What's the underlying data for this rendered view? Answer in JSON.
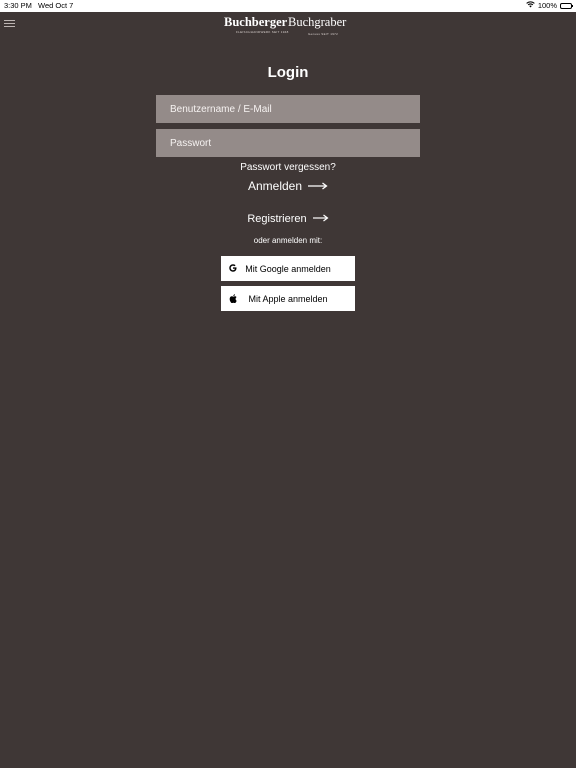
{
  "status_bar": {
    "time": "3:30 PM",
    "date": "Wed Oct 7",
    "battery": "100%"
  },
  "logo": {
    "left": "Buchberger",
    "left_sub": "FLEISCHHANDWERK SEIT 1948",
    "right": "Buchgraber",
    "right_sub": "Genuss SEIT 1972"
  },
  "login": {
    "title": "Login",
    "username_placeholder": "Benutzername / E-Mail",
    "password_placeholder": "Passwort",
    "forgot_password": "Passwort vergessen?",
    "login_button": "Anmelden",
    "register_button": "Registrieren",
    "alt_login_text": "oder anmelden mit:",
    "google_button": "Mit Google anmelden",
    "apple_button": "Mit Apple anmelden"
  },
  "colors": {
    "background": "#3f3736",
    "input_background": "#948b89",
    "button_background": "#ffffff"
  },
  "icons": {
    "menu": "hamburger-menu-icon",
    "wifi": "wifi-icon",
    "battery": "battery-icon",
    "arrow": "long-right-arrow-icon",
    "google": "google-g-icon",
    "apple": "apple-logo-icon"
  }
}
